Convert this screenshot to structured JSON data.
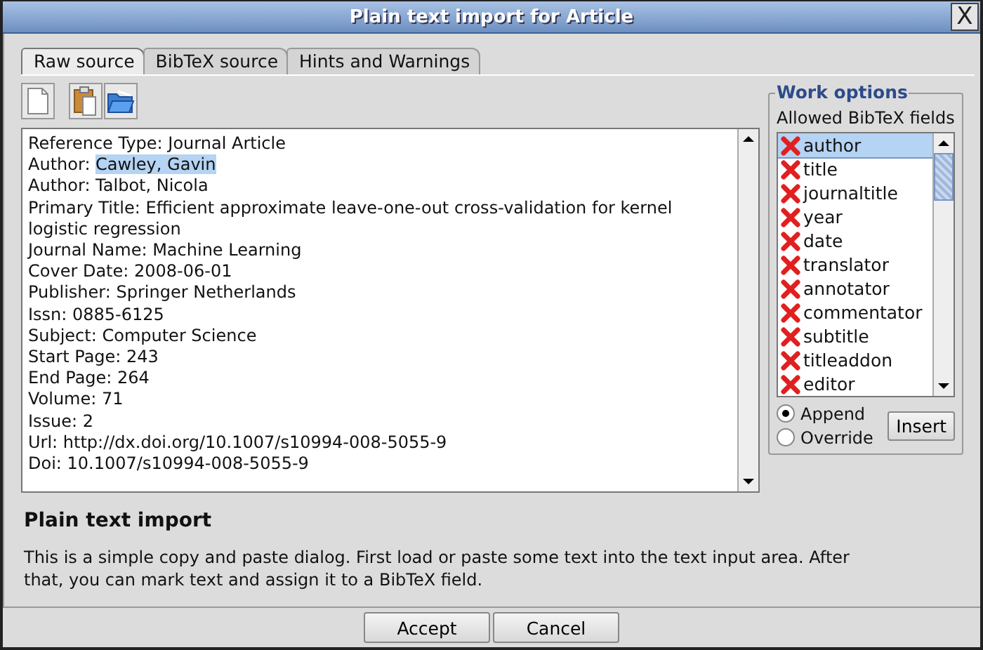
{
  "window": {
    "title": "Plain text import for Article",
    "close": "X"
  },
  "tabs": [
    {
      "label": "Raw source",
      "selected": true
    },
    {
      "label": "BibTeX source",
      "selected": false
    },
    {
      "label": "Hints and Warnings",
      "selected": false
    }
  ],
  "toolbar": [
    {
      "kind": "new"
    },
    {
      "kind": "paste"
    },
    {
      "kind": "open"
    }
  ],
  "source_text": {
    "lines": [
      [
        {
          "text": "Reference Type: Journal Article",
          "selected": false
        }
      ],
      [
        {
          "text": "Author: ",
          "selected": false
        },
        {
          "text": "Cawley, Gavin",
          "selected": true
        }
      ],
      [
        {
          "text": "Author: Talbot, Nicola",
          "selected": false
        }
      ],
      [
        {
          "text": "Primary Title: Efficient approximate leave-one-out cross-validation for kernel logistic regression",
          "selected": false
        }
      ],
      [
        {
          "text": "Journal Name: Machine Learning",
          "selected": false
        }
      ],
      [
        {
          "text": "Cover Date: 2008-06-01",
          "selected": false
        }
      ],
      [
        {
          "text": "Publisher: Springer Netherlands",
          "selected": false
        }
      ],
      [
        {
          "text": "Issn: 0885-6125",
          "selected": false
        }
      ],
      [
        {
          "text": "Subject: Computer Science",
          "selected": false
        }
      ],
      [
        {
          "text": "Start Page: 243",
          "selected": false
        }
      ],
      [
        {
          "text": "End Page: 264",
          "selected": false
        }
      ],
      [
        {
          "text": "Volume: 71",
          "selected": false
        }
      ],
      [
        {
          "text": "Issue: 2",
          "selected": false
        }
      ],
      [
        {
          "text": "Url: http://dx.doi.org/10.1007/s10994-008-5055-9",
          "selected": false
        }
      ],
      [
        {
          "text": "Doi: 10.1007/s10994-008-5055-9",
          "selected": false
        }
      ]
    ]
  },
  "work_options": {
    "title": "Work options",
    "fields_label": "Allowed BibTeX fields",
    "fields": [
      {
        "label": "author",
        "selected": true
      },
      {
        "label": "title",
        "selected": false
      },
      {
        "label": "journaltitle",
        "selected": false
      },
      {
        "label": "year",
        "selected": false
      },
      {
        "label": "date",
        "selected": false
      },
      {
        "label": "translator",
        "selected": false
      },
      {
        "label": "annotator",
        "selected": false
      },
      {
        "label": "commentator",
        "selected": false
      },
      {
        "label": "subtitle",
        "selected": false
      },
      {
        "label": "titleaddon",
        "selected": false
      },
      {
        "label": "editor",
        "selected": false
      }
    ],
    "modes": [
      {
        "label": "Append",
        "selected": true
      },
      {
        "label": "Override",
        "selected": false
      }
    ],
    "insert_button": "Insert"
  },
  "help": {
    "title": "Plain text import",
    "text": "This is a simple copy and paste dialog. First load or paste some text into the text input area. After that, you can mark text and assign it to a BibTeX field."
  },
  "buttons": [
    "Accept",
    "Cancel"
  ]
}
